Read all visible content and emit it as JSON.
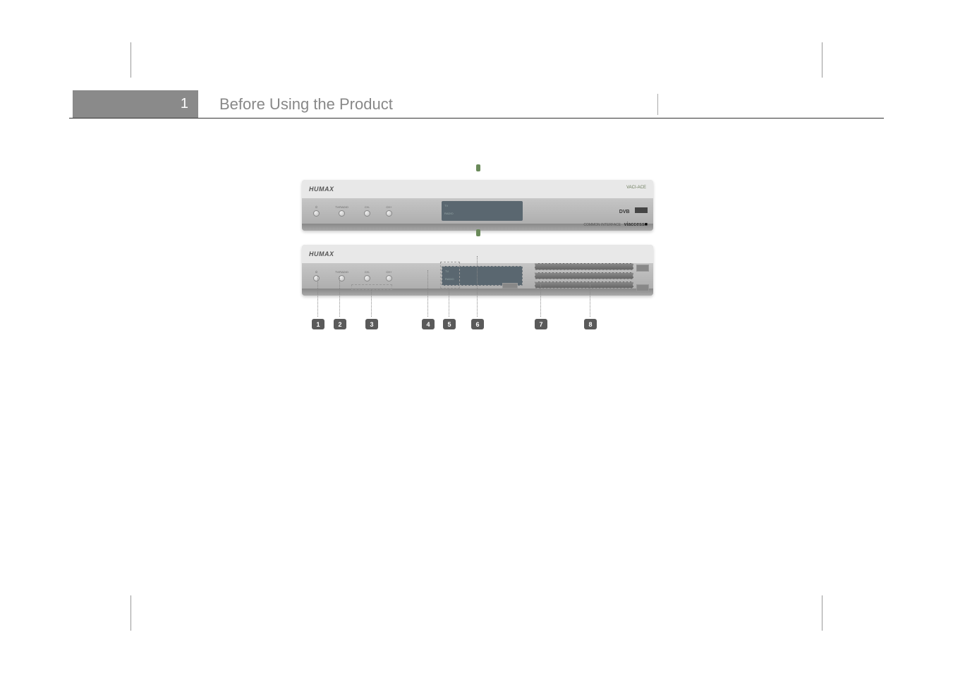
{
  "section": {
    "number": "1",
    "title": "Before Using the Product"
  },
  "device": {
    "brand": "HUMAX",
    "model": "VACI-ACE",
    "buttons": {
      "standby": "",
      "tvradio": "TV/RADIO",
      "ch_down": "CH-",
      "ch_up": "CH+"
    },
    "display": {
      "tv": "TV",
      "radio": "RADIO"
    },
    "logos": {
      "dvb": "DVB",
      "common_interface": "COMMON INTERFACE",
      "viaccess": "viaccess"
    }
  },
  "callouts": {
    "n1": "1",
    "n2": "2",
    "n3": "3",
    "n4": "4",
    "n5": "5",
    "n6": "6",
    "n7": "7",
    "n8": "8"
  }
}
